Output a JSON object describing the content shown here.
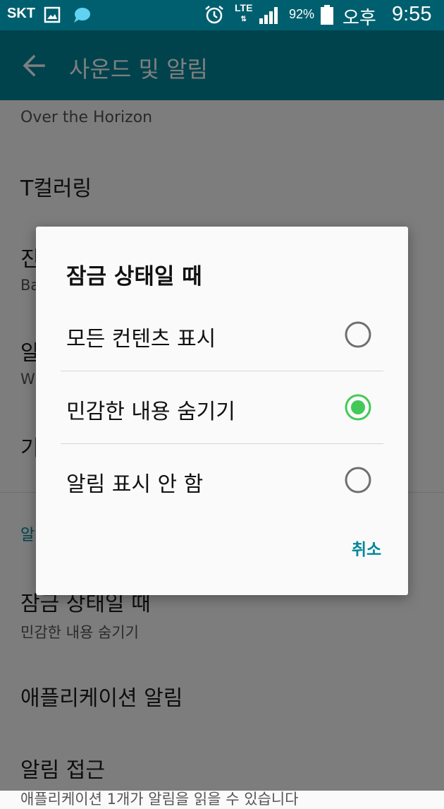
{
  "status_bar": {
    "carrier": "SKT",
    "network": "LTE",
    "battery": "92%",
    "ampm": "오후",
    "time": "9:55"
  },
  "app_bar": {
    "title": "사운드 및 알림"
  },
  "settings": {
    "ringtone_summary": "Over the Horizon",
    "t_coloring": "T컬러링",
    "row_vibration_partial": "진",
    "row_vibration_sub_partial": "Ba",
    "row_notification_partial": "알",
    "row_notification_sub_partial": "W",
    "row_other_partial": "기",
    "section_partial": "알",
    "lock_screen_label": "잠금 상태일 때",
    "lock_screen_value": "민감한 내용 숨기기",
    "app_notifications": "애플리케이션 알림",
    "notification_access": "알림 접근",
    "notification_access_sub": "애플리케이션 1개가 알림을 읽을 수 있습니다"
  },
  "dialog": {
    "title": "잠금 상태일 때",
    "options": [
      {
        "label": "모든 컨텐츠 표시",
        "selected": false
      },
      {
        "label": "민감한 내용 숨기기",
        "selected": true
      },
      {
        "label": "알림 표시 안 함",
        "selected": false
      }
    ],
    "cancel": "취소"
  },
  "colors": {
    "status_bar": "#005f6e",
    "app_bar": "#00869a",
    "radio_selected": "#43c957",
    "radio_unselected": "#6f6f6f",
    "accent_text": "#00869a"
  }
}
